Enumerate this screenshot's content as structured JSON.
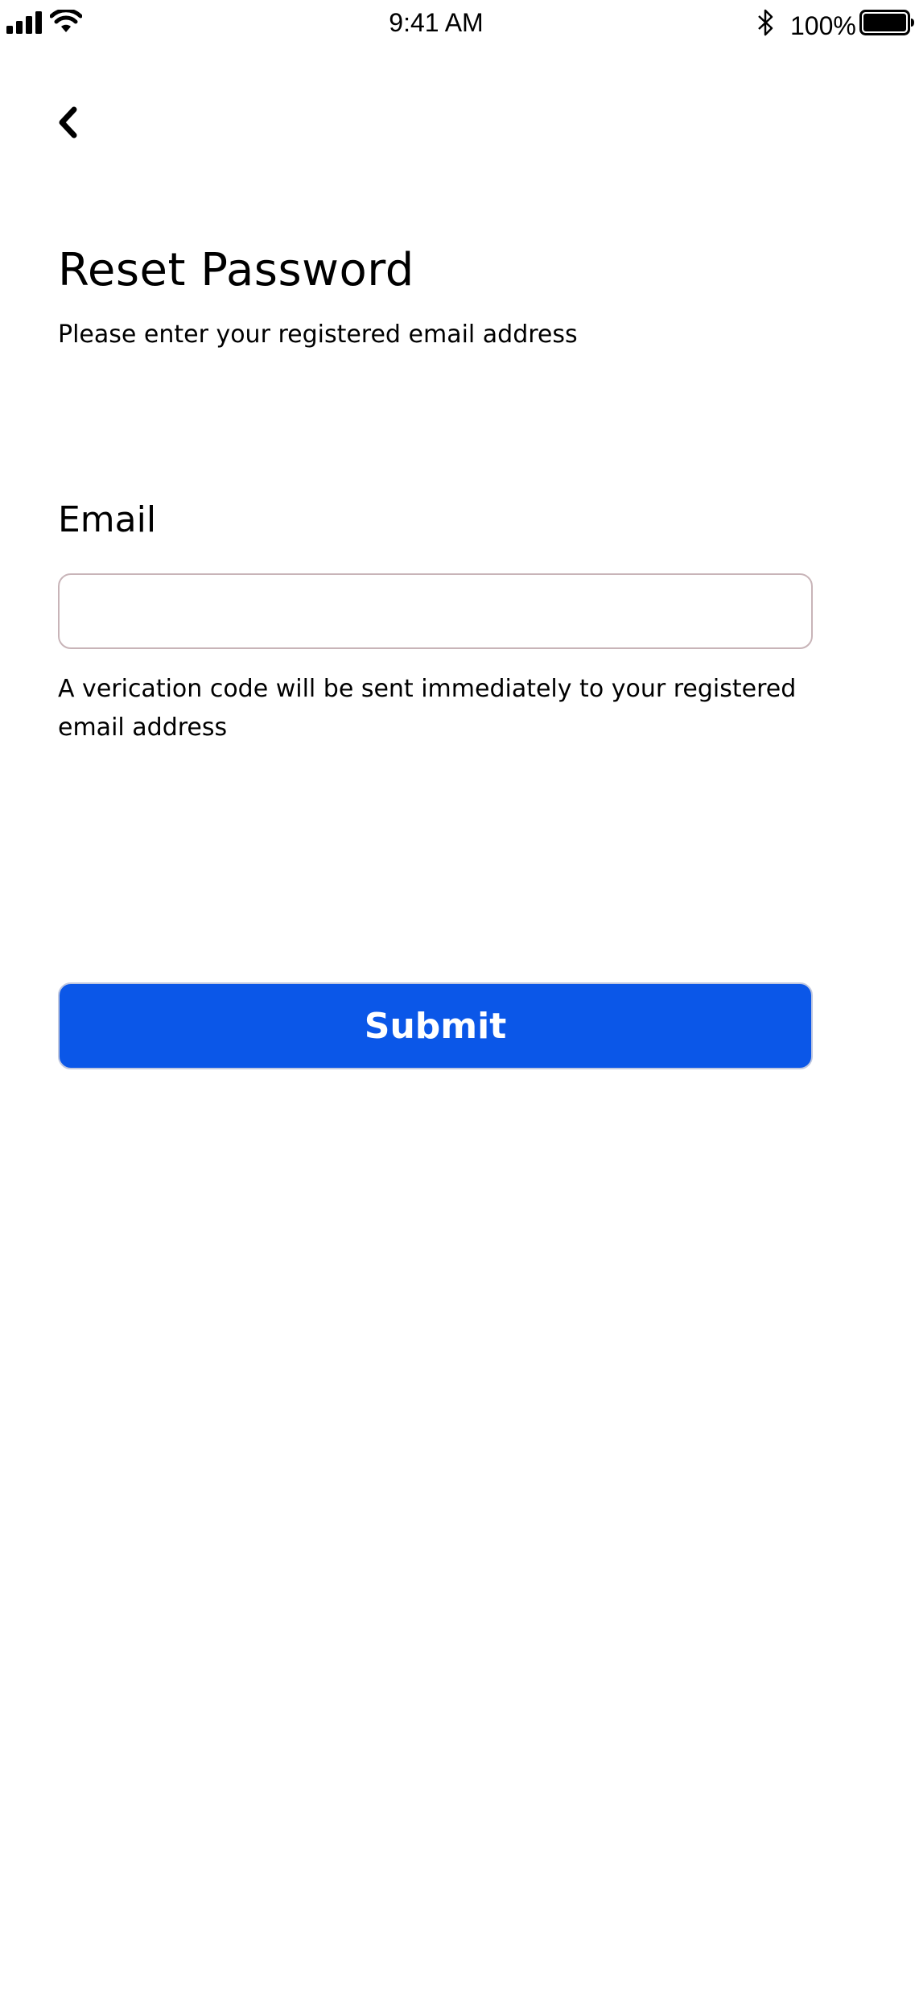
{
  "status_bar": {
    "time": "9:41 AM",
    "battery_percent": "100%",
    "icons": [
      "signal-icon",
      "wifi-icon",
      "bluetooth-icon",
      "battery-icon"
    ]
  },
  "header": {
    "back_icon": "chevron-left-icon"
  },
  "main": {
    "title": "Reset Password",
    "subtitle": "Please enter your registered email address",
    "email_label": "Email",
    "email_value": "",
    "email_placeholder": "",
    "helper_text": "A verication code will be sent immediately to your registered email address",
    "submit_label": "Submit"
  },
  "colors": {
    "primary": "#0b57e8",
    "input_border": "#c8b4b8",
    "text": "#000000",
    "background": "#ffffff"
  }
}
